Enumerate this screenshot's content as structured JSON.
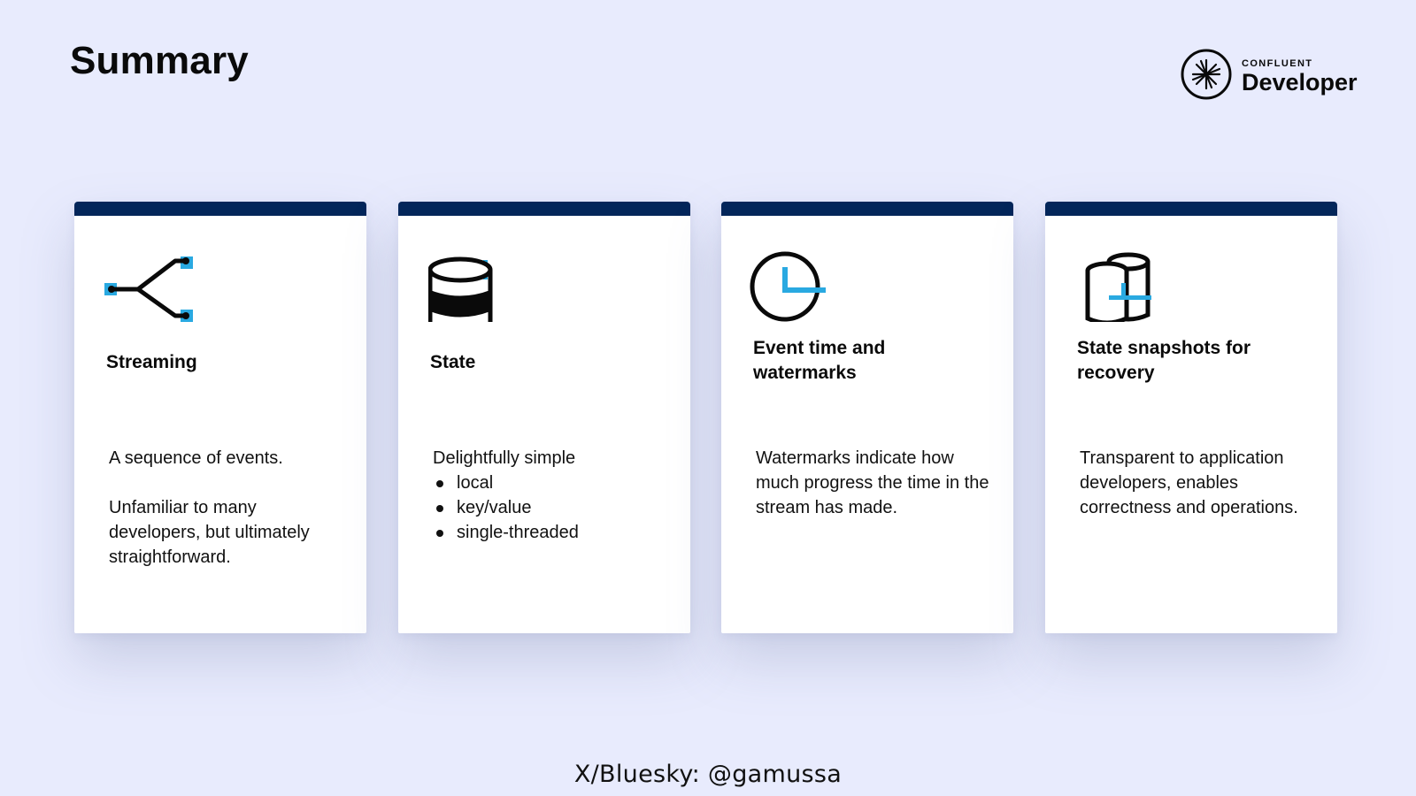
{
  "slide": {
    "title": "Summary"
  },
  "logo": {
    "small": "CONFLUENT",
    "big": "Developer",
    "icon": "confluent-starburst-icon"
  },
  "colors": {
    "background": "#e8ebfd",
    "card_bar": "#03265a",
    "accent": "#29a9e1"
  },
  "cards": [
    {
      "icon": "branching-stream-icon",
      "title": "Streaming",
      "body": [
        "A sequence of events.",
        "Unfamiliar to many developers, but ultimately straightforward."
      ]
    },
    {
      "icon": "database-icon",
      "title": "State",
      "intro": "Delightfully simple",
      "bullets": [
        "local",
        "key/value",
        "single-threaded"
      ]
    },
    {
      "icon": "clock-icon",
      "title": "Event time and watermarks",
      "body": [
        "Watermarks indicate how much progress the time in the stream has made."
      ]
    },
    {
      "icon": "snapshot-cylinders-icon",
      "title": "State snapshots for recovery",
      "body": [
        "Transparent to application developers, enables correctness and operations."
      ]
    }
  ],
  "footer": {
    "handle": "X/Bluesky: @gamussa"
  }
}
